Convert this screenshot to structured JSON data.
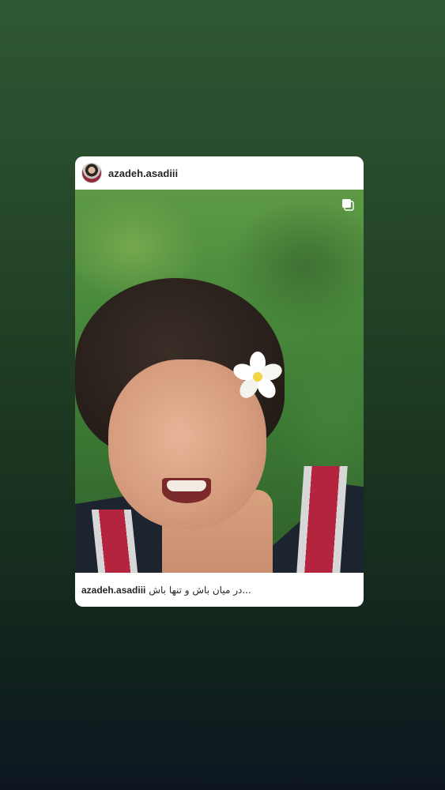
{
  "post": {
    "username": "azadeh.asadiii",
    "caption_user": "azadeh.asadiii",
    "caption_text": "در میان باش و تنها باش...",
    "avatar_icon": "profile-avatar",
    "multi_media_icon": "carousel-icon"
  },
  "colors": {
    "background_top": "#2f5733",
    "background_bottom": "#0d1620",
    "card": "#ffffff",
    "text": "#262626"
  }
}
